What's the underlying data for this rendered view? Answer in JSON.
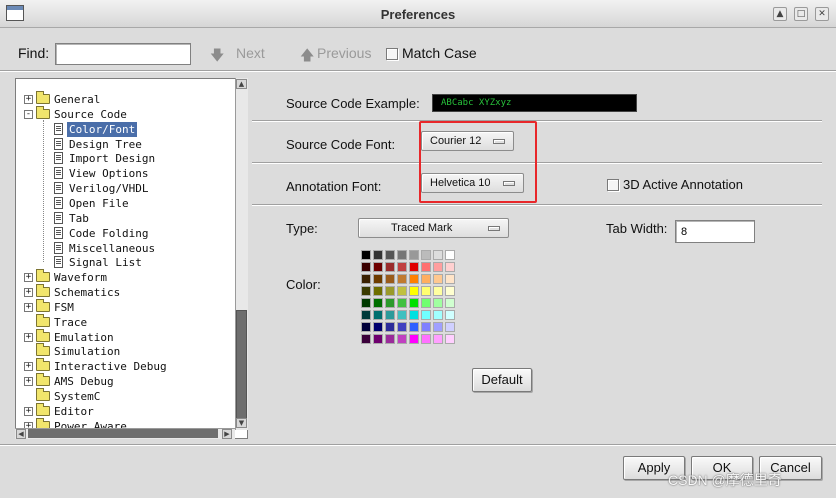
{
  "window": {
    "title": "Preferences"
  },
  "find": {
    "label": "Find:",
    "value": "",
    "next_label": "Next",
    "previous_label": "Previous",
    "match_case_label": "Match Case"
  },
  "tree": [
    {
      "label": "General",
      "level": 0,
      "icon": "folder",
      "expander": "+"
    },
    {
      "label": "Source Code",
      "level": 0,
      "icon": "folder-open",
      "expander": "-"
    },
    {
      "label": "Color/Font",
      "level": 1,
      "icon": "document",
      "selected": true
    },
    {
      "label": "Design Tree",
      "level": 1,
      "icon": "document"
    },
    {
      "label": "Import Design",
      "level": 1,
      "icon": "document"
    },
    {
      "label": "View Options",
      "level": 1,
      "icon": "document"
    },
    {
      "label": "Verilog/VHDL",
      "level": 1,
      "icon": "document"
    },
    {
      "label": "Open File",
      "level": 1,
      "icon": "document"
    },
    {
      "label": "Tab",
      "level": 1,
      "icon": "document"
    },
    {
      "label": "Code Folding",
      "level": 1,
      "icon": "document"
    },
    {
      "label": "Miscellaneous",
      "level": 1,
      "icon": "document"
    },
    {
      "label": "Signal List",
      "level": 1,
      "icon": "document"
    },
    {
      "label": "Waveform",
      "level": 0,
      "icon": "folder",
      "expander": "+"
    },
    {
      "label": "Schematics",
      "level": 0,
      "icon": "folder",
      "expander": "+"
    },
    {
      "label": "FSM",
      "level": 0,
      "icon": "folder",
      "expander": "+"
    },
    {
      "label": "Trace",
      "level": 0,
      "icon": "folder"
    },
    {
      "label": "Emulation",
      "level": 0,
      "icon": "folder",
      "expander": "+"
    },
    {
      "label": "Simulation",
      "level": 0,
      "icon": "folder"
    },
    {
      "label": "Interactive Debug",
      "level": 0,
      "icon": "folder",
      "expander": "+"
    },
    {
      "label": "AMS Debug",
      "level": 0,
      "icon": "folder",
      "expander": "+"
    },
    {
      "label": "SystemC",
      "level": 0,
      "icon": "folder"
    },
    {
      "label": "Editor",
      "level": 0,
      "icon": "folder",
      "expander": "+"
    },
    {
      "label": "Power Aware",
      "level": 0,
      "icon": "folder",
      "expander": "+"
    }
  ],
  "settings": {
    "example_label": "Source Code Example:",
    "example_text": "ABCabc XYZxyz",
    "example_fg": "#27c23a",
    "example_bg": "#000000",
    "font_label": "Source Code Font:",
    "font_value": "Courier 12",
    "annotation_font_label": "Annotation Font:",
    "annotation_font_value": "Helvetica 10",
    "annotation_3d_label": "3D Active Annotation",
    "type_label": "Type:",
    "type_value": "Traced Mark",
    "tab_width_label": "Tab Width:",
    "tab_width_value": "8",
    "color_label": "Color:",
    "default_button": "Default",
    "highlight_color": "#e8272a"
  },
  "palette": [
    [
      "#000000",
      "#333333",
      "#555555",
      "#777777",
      "#999999",
      "#bbbbbb",
      "#dddddd",
      "#ffffff"
    ],
    [
      "#3a0000",
      "#6e0000",
      "#9a2b2b",
      "#c04040",
      "#e00000",
      "#ff7070",
      "#ff9f9f",
      "#ffd0d0"
    ],
    [
      "#3a2000",
      "#6e3c00",
      "#9a5b1b",
      "#c07a30",
      "#ff8000",
      "#ffae60",
      "#ffc890",
      "#ffe4c8"
    ],
    [
      "#3a3a00",
      "#6e6e00",
      "#9a9a2b",
      "#c0c040",
      "#ffff00",
      "#ffff70",
      "#ffffa0",
      "#ffffd0"
    ],
    [
      "#003a00",
      "#006e00",
      "#2b9a2b",
      "#40c040",
      "#00e000",
      "#70ff70",
      "#a0ffa0",
      "#d0ffd0"
    ],
    [
      "#003a3a",
      "#006e6e",
      "#2b9a9a",
      "#40c0c0",
      "#00e0e0",
      "#70ffff",
      "#a0ffff",
      "#d0ffff"
    ],
    [
      "#00003a",
      "#00006e",
      "#2b2b9a",
      "#4040c0",
      "#3060ff",
      "#8080ff",
      "#a0a0ff",
      "#d0d0ff"
    ],
    [
      "#3a003a",
      "#6e006e",
      "#9a2b9a",
      "#c040c0",
      "#ff00ff",
      "#ff70ff",
      "#ffa0ff",
      "#ffd0ff"
    ]
  ],
  "footer": {
    "apply": "Apply",
    "ok": "OK",
    "cancel": "Cancel"
  },
  "watermark": "CSDN @摩德里奇"
}
